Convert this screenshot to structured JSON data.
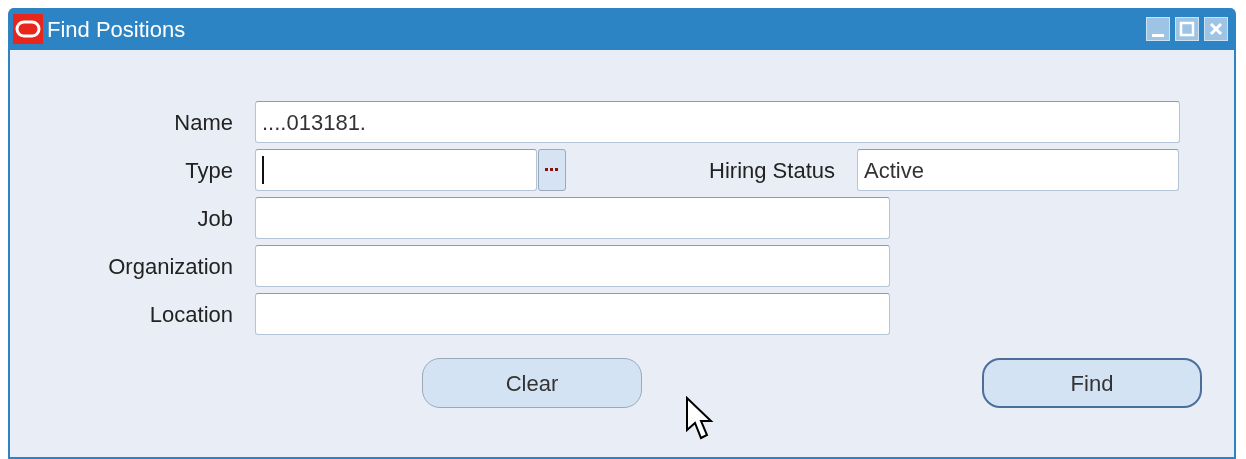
{
  "window": {
    "title": "Find Positions"
  },
  "fields": [
    {
      "kind": "wide",
      "label": "Name",
      "value": "....013181.",
      "focused": false
    },
    {
      "kind": "lov",
      "label": "Type",
      "focused": true,
      "side_label": "Hiring Status",
      "side_value": "Active"
    },
    {
      "kind": "text",
      "label": "Job",
      "focused": false
    },
    {
      "kind": "text",
      "label": "Organization",
      "focused": false
    },
    {
      "kind": "text",
      "label": "Location",
      "focused": false
    }
  ],
  "buttons": [
    {
      "label": "Clear",
      "default": false
    },
    {
      "label": "Find",
      "default": true
    }
  ]
}
